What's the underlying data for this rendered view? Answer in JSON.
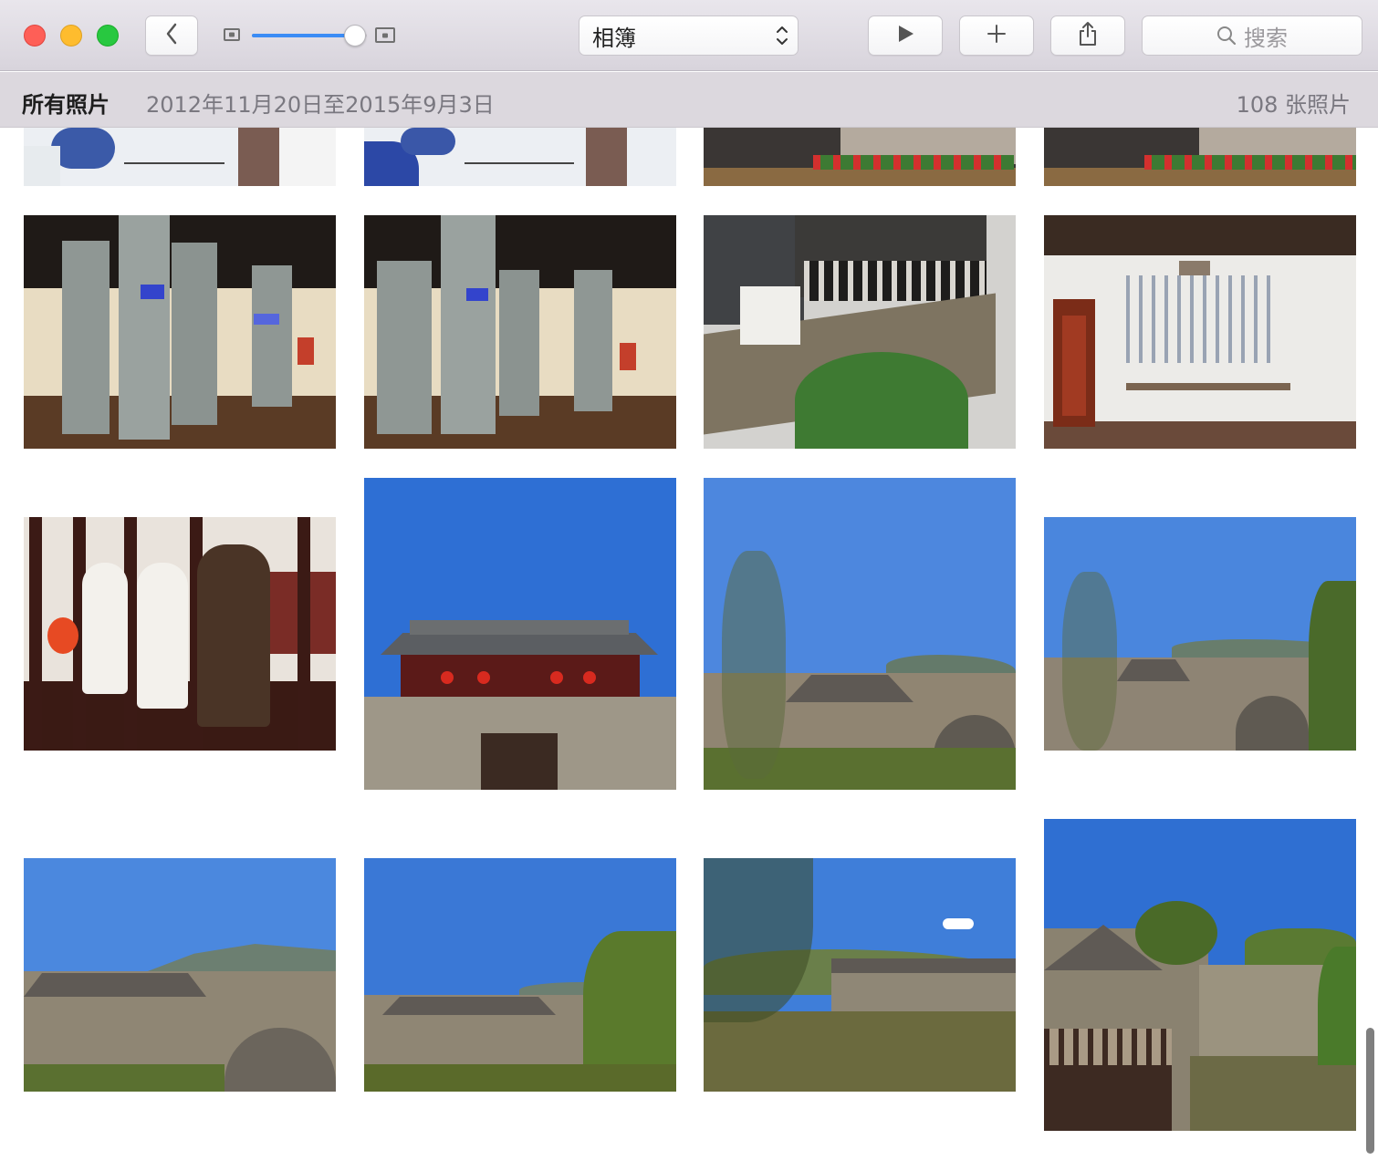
{
  "window": {
    "album_select": {
      "value": "相簿"
    },
    "search": {
      "placeholder": "搜索"
    },
    "zoom_level": 0.9
  },
  "subheader": {
    "title": "所有照片",
    "date_range": "2012年11月20日至2015年9月3日",
    "photo_count": "108 张照片"
  },
  "icons": {
    "back": "chevron-left-icon",
    "play": "play-icon",
    "add": "plus-icon",
    "share": "share-icon",
    "search": "search-icon",
    "zoom_small": "photo-small-icon",
    "zoom_large": "photo-large-icon"
  },
  "colors": {
    "accent": "#3b8cf5",
    "close": "#fe5f57",
    "minimize": "#febc2e",
    "maximize": "#28c840"
  },
  "photos": [
    {
      "id": "r0c0",
      "subject": "mural"
    },
    {
      "id": "r0c1",
      "subject": "mural"
    },
    {
      "id": "r0c2",
      "subject": "flowers-hall"
    },
    {
      "id": "r0c3",
      "subject": "flowers-hall"
    },
    {
      "id": "r1c0",
      "subject": "museum-hall"
    },
    {
      "id": "r1c1",
      "subject": "museum-hall"
    },
    {
      "id": "r1c2",
      "subject": "wall-plaque"
    },
    {
      "id": "r1c3",
      "subject": "white-room"
    },
    {
      "id": "r2c0",
      "subject": "statues"
    },
    {
      "id": "r2c1",
      "subject": "gate-building"
    },
    {
      "id": "r2c2",
      "subject": "village"
    },
    {
      "id": "r2c3",
      "subject": "village"
    },
    {
      "id": "r3c0",
      "subject": "village"
    },
    {
      "id": "r3c1",
      "subject": "village"
    },
    {
      "id": "r3c2",
      "subject": "river"
    },
    {
      "id": "r3c3",
      "subject": "river-house"
    }
  ]
}
